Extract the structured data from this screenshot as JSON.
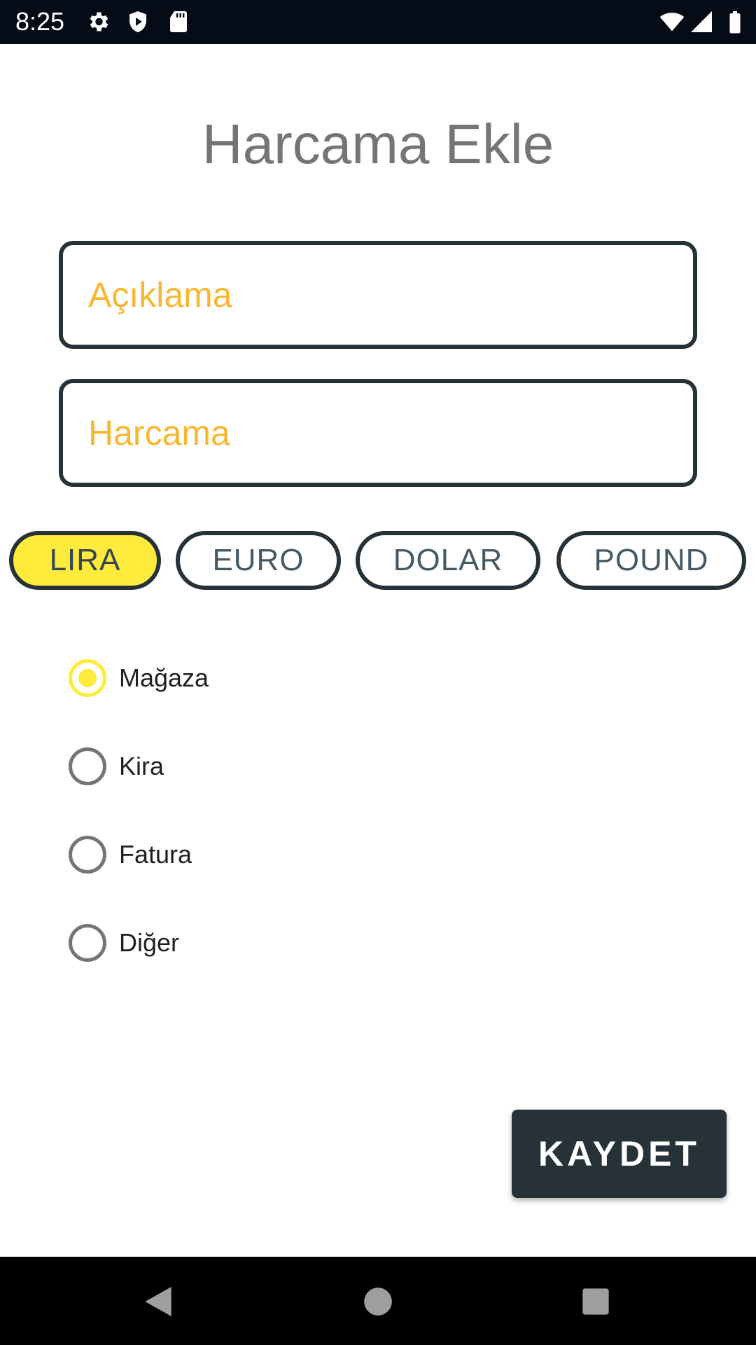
{
  "status_bar": {
    "time": "8:25",
    "icons_left": [
      "gear-icon",
      "shield-play-icon",
      "sd-card-icon"
    ],
    "icons_right": [
      "wifi-icon",
      "signal-icon",
      "battery-icon"
    ]
  },
  "page": {
    "title": "Harcama Ekle"
  },
  "form": {
    "description_placeholder": "Açıklama",
    "description_value": "",
    "amount_placeholder": "Harcama",
    "amount_value": ""
  },
  "currencies": [
    {
      "label": "LIRA",
      "selected": true
    },
    {
      "label": "EURO",
      "selected": false
    },
    {
      "label": "DOLAR",
      "selected": false
    },
    {
      "label": "POUND",
      "selected": false
    }
  ],
  "categories": [
    {
      "label": "Mağaza",
      "checked": true
    },
    {
      "label": "Kira",
      "checked": false
    },
    {
      "label": "Fatura",
      "checked": false
    },
    {
      "label": "Diğer",
      "checked": false
    }
  ],
  "actions": {
    "save_label": "KAYDET"
  },
  "nav_bar": {
    "icons": [
      "back-icon",
      "home-icon",
      "recents-icon"
    ]
  },
  "colors": {
    "accent_yellow": "#ffeb3b",
    "placeholder_orange": "#f7b731",
    "dark": "#263238",
    "title_gray": "#757575"
  }
}
